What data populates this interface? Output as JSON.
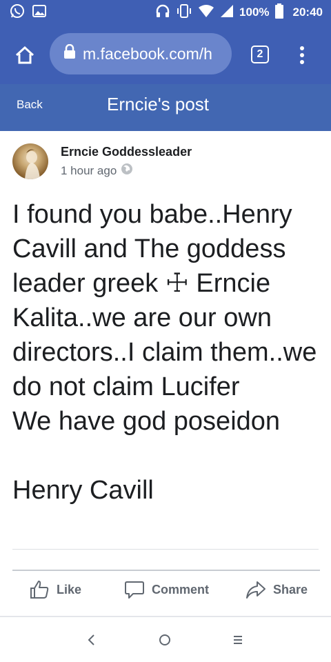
{
  "status_bar": {
    "left_icons": [
      "whatsapp-icon",
      "gallery-icon"
    ],
    "right_icons": [
      "headphones-icon",
      "vibrate-icon",
      "wifi-icon",
      "signal-icon",
      "battery-icon"
    ],
    "battery": "100%",
    "time": "20:40"
  },
  "browser": {
    "url": "m.facebook.com/h",
    "tab_count": "2"
  },
  "header": {
    "back_label": "Back",
    "title": "Erncie's post"
  },
  "post": {
    "author": "Erncie Goddessleader",
    "time_ago": "1 hour ago",
    "body": "I found you babe..Henry Cavill and The goddess leader greek ☩ Erncie Kalita..we are our own directors..I claim them..we do not claim Lucifer\nWe have god poseidon\n\nHenry Cavill"
  },
  "actions": {
    "like": "Like",
    "comment": "Comment",
    "share": "Share"
  },
  "colors": {
    "browser_bar": "#3f5fb4",
    "fb_header": "#4267b2",
    "url_pill": "#6a85cc",
    "action_text": "#606770"
  }
}
